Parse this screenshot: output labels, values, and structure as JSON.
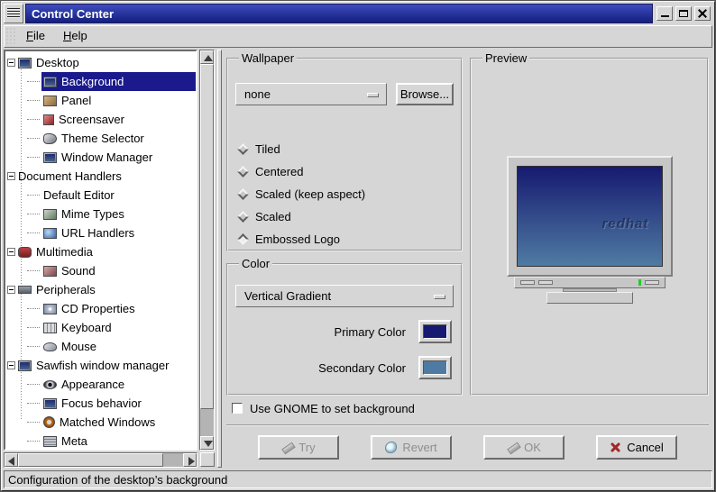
{
  "colors": {
    "window_bg": "#d6d6d6",
    "titlebar_top": "#3d4cc0",
    "titlebar_bottom": "#141e7d",
    "selection": "#1a1a8c",
    "primary_color": "#161a70",
    "secondary_color": "#4f7ba3",
    "led_green": "#22cc22"
  },
  "window": {
    "title": "Control Center",
    "controls": [
      {
        "name": "minimize-button",
        "icon": "minimize-icon"
      },
      {
        "name": "maximize-button",
        "icon": "maximize-icon"
      },
      {
        "name": "close-button",
        "icon": "close-icon"
      }
    ]
  },
  "menu": {
    "items": [
      {
        "key": "F",
        "rest": "ile",
        "label": "File"
      },
      {
        "key": "H",
        "rest": "elp",
        "label": "Help"
      }
    ]
  },
  "tree": {
    "items": [
      {
        "label": "Desktop",
        "level": 0,
        "icon": "desktop-icon",
        "monitor": true,
        "expander": true,
        "selected": false
      },
      {
        "label": "Background",
        "level": 1,
        "icon": "background-icon",
        "monitor": true,
        "expander": false,
        "selected": true
      },
      {
        "label": "Panel",
        "level": 1,
        "icon": "panel-icon",
        "monitor": false,
        "expander": false,
        "selected": false
      },
      {
        "label": "Screensaver",
        "level": 1,
        "icon": "screensaver-icon",
        "monitor": false,
        "expander": false,
        "selected": false
      },
      {
        "label": "Theme Selector",
        "level": 1,
        "icon": "theme-selector-icon",
        "monitor": false,
        "expander": false,
        "selected": false
      },
      {
        "label": "Window Manager",
        "level": 1,
        "icon": "window-manager-icon",
        "monitor": true,
        "expander": false,
        "selected": false
      },
      {
        "label": "Document Handlers",
        "level": 0,
        "icon": "none",
        "monitor": false,
        "expander": true,
        "selected": false
      },
      {
        "label": "Default Editor",
        "level": 1,
        "icon": "none",
        "monitor": false,
        "expander": false,
        "selected": false
      },
      {
        "label": "Mime Types",
        "level": 1,
        "icon": "mime-types-icon",
        "monitor": false,
        "expander": false,
        "selected": false
      },
      {
        "label": "URL Handlers",
        "level": 1,
        "icon": "url-handlers-icon",
        "monitor": false,
        "expander": false,
        "selected": false
      },
      {
        "label": "Multimedia",
        "level": 0,
        "icon": "multimedia-icon",
        "monitor": false,
        "expander": true,
        "selected": false
      },
      {
        "label": "Sound",
        "level": 1,
        "icon": "sound-icon",
        "monitor": false,
        "expander": false,
        "selected": false
      },
      {
        "label": "Peripherals",
        "level": 0,
        "icon": "peripherals-icon",
        "monitor": false,
        "expander": true,
        "selected": false
      },
      {
        "label": "CD Properties",
        "level": 1,
        "icon": "cd-properties-icon",
        "monitor": false,
        "expander": false,
        "selected": false
      },
      {
        "label": "Keyboard",
        "level": 1,
        "icon": "keyboard-icon",
        "monitor": false,
        "expander": false,
        "selected": false
      },
      {
        "label": "Mouse",
        "level": 1,
        "icon": "mouse-icon",
        "monitor": false,
        "expander": false,
        "selected": false
      },
      {
        "label": "Sawfish window manager",
        "level": 0,
        "icon": "sawfish-icon",
        "monitor": true,
        "expander": true,
        "selected": false
      },
      {
        "label": "Appearance",
        "level": 1,
        "icon": "appearance-icon",
        "monitor": false,
        "expander": false,
        "selected": false
      },
      {
        "label": "Focus behavior",
        "level": 1,
        "icon": "focus-behavior-icon",
        "monitor": true,
        "expander": false,
        "selected": false
      },
      {
        "label": "Matched Windows",
        "level": 1,
        "icon": "matched-windows-icon",
        "monitor": false,
        "expander": false,
        "selected": false
      },
      {
        "label": "Meta",
        "level": 1,
        "icon": "meta-icon",
        "monitor": false,
        "expander": false,
        "selected": false
      }
    ]
  },
  "wallpaper": {
    "legend": "Wallpaper",
    "selected_file": "none",
    "browse_label": "Browse...",
    "modes": [
      {
        "label": "Tiled",
        "selected": false
      },
      {
        "label": "Centered",
        "selected": false
      },
      {
        "label": "Scaled (keep aspect)",
        "selected": false
      },
      {
        "label": "Scaled",
        "selected": false
      },
      {
        "label": "Embossed Logo",
        "selected": true
      }
    ]
  },
  "color": {
    "legend": "Color",
    "gradient_type": "Vertical Gradient",
    "primary_label": "Primary Color",
    "secondary_label": "Secondary Color",
    "primary_hex": "#161a70",
    "secondary_hex": "#4f7ba3"
  },
  "preview": {
    "legend": "Preview",
    "logo_text": "redhat"
  },
  "gnome_checkbox": {
    "label": "Use GNOME to set background",
    "checked": false
  },
  "actions": [
    {
      "label": "Try",
      "icon": "pencil-icon",
      "enabled": false
    },
    {
      "label": "Revert",
      "icon": "splat-icon",
      "enabled": false
    },
    {
      "label": "OK",
      "icon": "pencil-icon",
      "enabled": false
    },
    {
      "label": "Cancel",
      "icon": "cross-icon",
      "enabled": true
    }
  ],
  "statusbar": {
    "text": "Configuration of the desktop’s background"
  }
}
